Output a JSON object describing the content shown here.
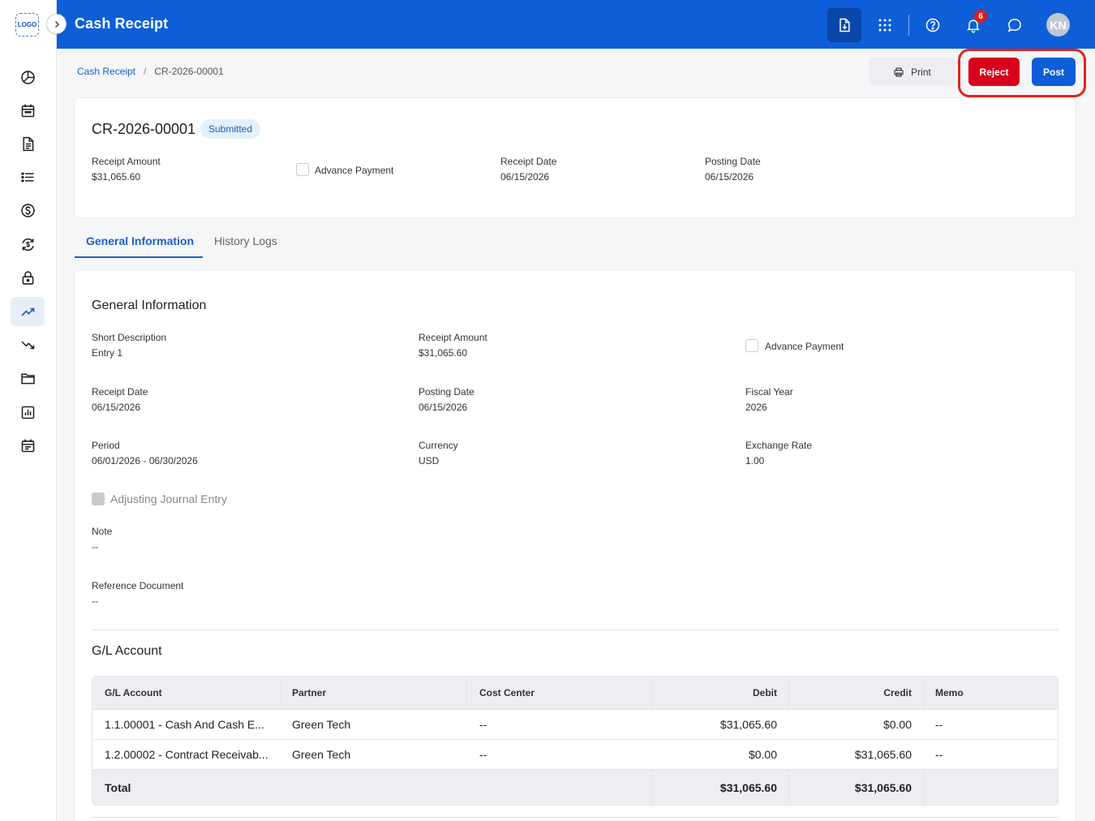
{
  "header": {
    "title": "Cash Receipt",
    "notification_count": "6",
    "avatar_initials": "KN"
  },
  "sidebar": {
    "logo_text": "LOGO",
    "items": [
      "pie-chart-icon",
      "calendar-icon",
      "document-icon",
      "list-icon",
      "dollar-icon",
      "refresh-dollar-icon",
      "lock-icon",
      "trending-up-icon",
      "trending-down-icon",
      "folder-icon",
      "report-chart-icon",
      "schedule-icon"
    ],
    "active_item": "trending-up-icon"
  },
  "breadcrumb": {
    "parent": "Cash Receipt",
    "separator": "/",
    "current": "CR-2026-00001"
  },
  "actions": {
    "print_label": "Print",
    "reject_label": "Reject",
    "post_label": "Post"
  },
  "summary": {
    "doc_number": "CR-2026-00001",
    "status": "Submitted",
    "receipt_amount_label": "Receipt Amount",
    "receipt_amount": "$31,065.60",
    "advance_payment_label": "Advance Payment",
    "advance_payment_checked": false,
    "receipt_date_label": "Receipt Date",
    "receipt_date": "06/15/2026",
    "posting_date_label": "Posting Date",
    "posting_date": "06/15/2026"
  },
  "tabs": [
    {
      "label": "General Information",
      "active": true
    },
    {
      "label": "History Logs",
      "active": false
    }
  ],
  "general": {
    "title": "General Information",
    "short_description_label": "Short Description",
    "short_description": "Entry 1",
    "receipt_amount_label": "Receipt Amount",
    "receipt_amount": "$31,065.60",
    "advance_payment_label": "Advance Payment",
    "receipt_date_label": "Receipt Date",
    "receipt_date": "06/15/2026",
    "posting_date_label": "Posting Date",
    "posting_date": "06/15/2026",
    "fiscal_year_label": "Fiscal Year",
    "fiscal_year": "2026",
    "period_label": "Period",
    "period": "06/01/2026 - 06/30/2026",
    "currency_label": "Currency",
    "currency": "USD",
    "exchange_rate_label": "Exchange Rate",
    "exchange_rate": "1.00",
    "adjusting_label": "Adjusting Journal Entry",
    "note_label": "Note",
    "note": "--",
    "reference_label": "Reference Document",
    "reference": "--"
  },
  "gl": {
    "title": "G/L Account",
    "columns": [
      "G/L Account",
      "Partner",
      "Cost Center",
      "Debit",
      "Credit",
      "Memo"
    ],
    "rows": [
      {
        "account": "1.1.00001 - Cash And Cash E...",
        "partner": "Green Tech",
        "cost_center": "--",
        "debit": "$31,065.60",
        "credit": "$0.00",
        "memo": "--"
      },
      {
        "account": "1.2.00002 - Contract Receivab...",
        "partner": "Green Tech",
        "cost_center": "--",
        "debit": "$0.00",
        "credit": "$31,065.60",
        "memo": "--"
      }
    ],
    "total_label": "Total",
    "total_debit": "$31,065.60",
    "total_credit": "$31,065.60"
  }
}
